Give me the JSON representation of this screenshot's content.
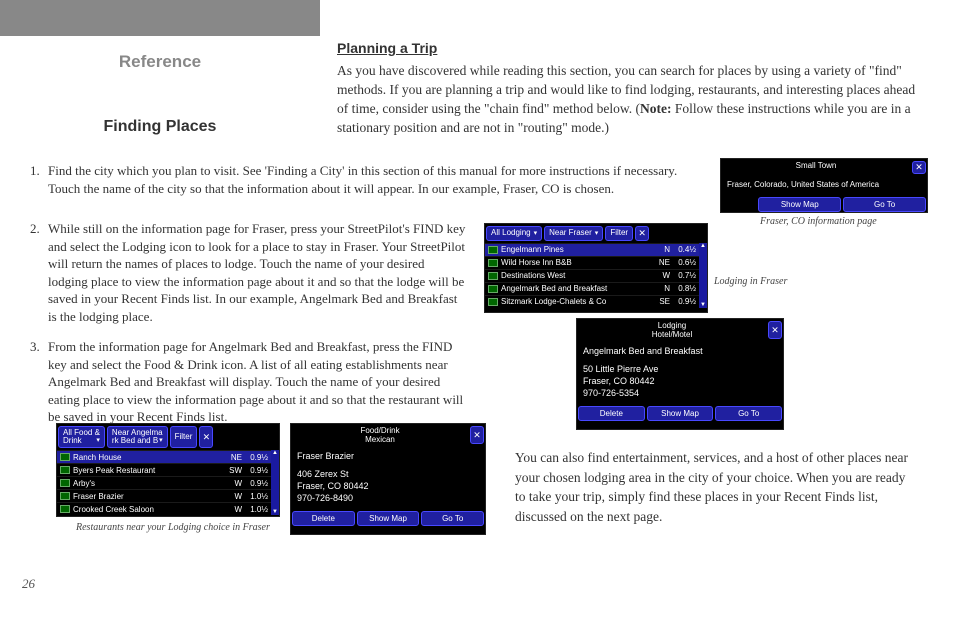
{
  "sidebar": {
    "title": "Reference",
    "subtitle": "Finding  Places"
  },
  "section_head": "Planning a Trip",
  "intro_a": "As you have discovered while reading this section, you can search for places by using a variety of \"find\" methods. If you are planning a trip and would like to find lodging, restaurants, and interesting places ahead of time, consider using the \"chain find\" method below. (",
  "intro_note": "Note:",
  "intro_b": " Follow these instructions while you are in a stationary position and are not in \"routing\" mode.)",
  "steps": {
    "s1n": "1.",
    "s1": "Find the city which you plan to visit. See 'Finding a City' in this section of this manual for more instructions if necessary. Touch the name of the city so that the information about it will appear. In our example, Fraser, CO is chosen.",
    "s2n": "2.",
    "s2": "While still on the information page for Fraser, press your StreetPilot's FIND key and select the Lodging icon to look for a place to stay in Fraser. Your StreetPilot will return the names of places to lodge. Touch the name of your desired lodging place to view the information page about it and so that the lodge will be saved in your Recent Finds list. In our example, Angelmark Bed and Breakfast is the lodging place.",
    "s3n": "3.",
    "s3": "From the information page for Angelmark Bed and Breakfast, press the FIND key and select the Food & Drink icon. A list of all eating establishments near Angelmark Bed and Breakfast will display.  Touch the name of your desired eating place to view the information page about it and so that the restaurant will be saved in your Recent Finds list."
  },
  "bottom": "You can also find entertainment, services, and a host of other places near your chosen lodging area in the city of your choice. When you are ready to take your trip, simply find these places in your Recent Finds list, discussed on the next page.",
  "page": "26",
  "captions": {
    "city": "Fraser, CO information page",
    "lodging": "Lodging in Fraser",
    "rest": "Restaurants near your Lodging choice in Fraser"
  },
  "gps_city": {
    "title": "Small Town",
    "line": "Fraser, Colorado, United States of America",
    "btns": [
      "Show Map",
      "Go To"
    ],
    "close": "✕"
  },
  "gps_lodging_list": {
    "tab1": "All Lodging",
    "tab2": "Near Fraser",
    "tab3": "Filter",
    "close": "✕",
    "rows": [
      {
        "name": "Engelmann Pines",
        "dir": "N",
        "dist": "0.4½"
      },
      {
        "name": "Wild Horse Inn B&B",
        "dir": "NE",
        "dist": "0.6½"
      },
      {
        "name": "Destinations West",
        "dir": "W",
        "dist": "0.7½"
      },
      {
        "name": "Angelmark Bed and Breakfast",
        "dir": "N",
        "dist": "0.8½"
      },
      {
        "name": "Sitzmark Lodge-Chalets & Co",
        "dir": "SE",
        "dist": "0.9½"
      }
    ],
    "scroll_up": "▲",
    "scroll_dn": "▼"
  },
  "gps_lodging_info": {
    "title1": "Lodging",
    "title2": "Hotel/Motel",
    "name": "Angelmark Bed and Breakfast",
    "addr1": "50 Little Pierre Ave",
    "addr2": "Fraser, CO 80442",
    "phone": "970-726-5354",
    "btns": [
      "Delete",
      "Show Map",
      "Go To"
    ],
    "close": "✕"
  },
  "gps_food_list": {
    "tab1a": "All Food &",
    "tab1b": "Drink",
    "tab2a": "Near Angelma",
    "tab2b": "rk Bed and B",
    "tab3": "Filter",
    "close": "✕",
    "rows": [
      {
        "name": "Ranch House",
        "dir": "NE",
        "dist": "0.9½"
      },
      {
        "name": "Byers Peak Restaurant",
        "dir": "SW",
        "dist": "0.9½"
      },
      {
        "name": "Arby's",
        "dir": "W",
        "dist": "0.9½"
      },
      {
        "name": "Fraser Brazier",
        "dir": "W",
        "dist": "1.0½"
      },
      {
        "name": "Crooked Creek Saloon",
        "dir": "W",
        "dist": "1.0½"
      }
    ],
    "scroll_up": "▲",
    "scroll_dn": "▼"
  },
  "gps_food_info": {
    "title1": "Food/Drink",
    "title2": "Mexican",
    "name": "Fraser Brazier",
    "addr1": "406 Zerex St",
    "addr2": "Fraser, CO 80442",
    "phone": "970-726-8490",
    "btns": [
      "Delete",
      "Show Map",
      "Go To"
    ],
    "close": "✕"
  }
}
